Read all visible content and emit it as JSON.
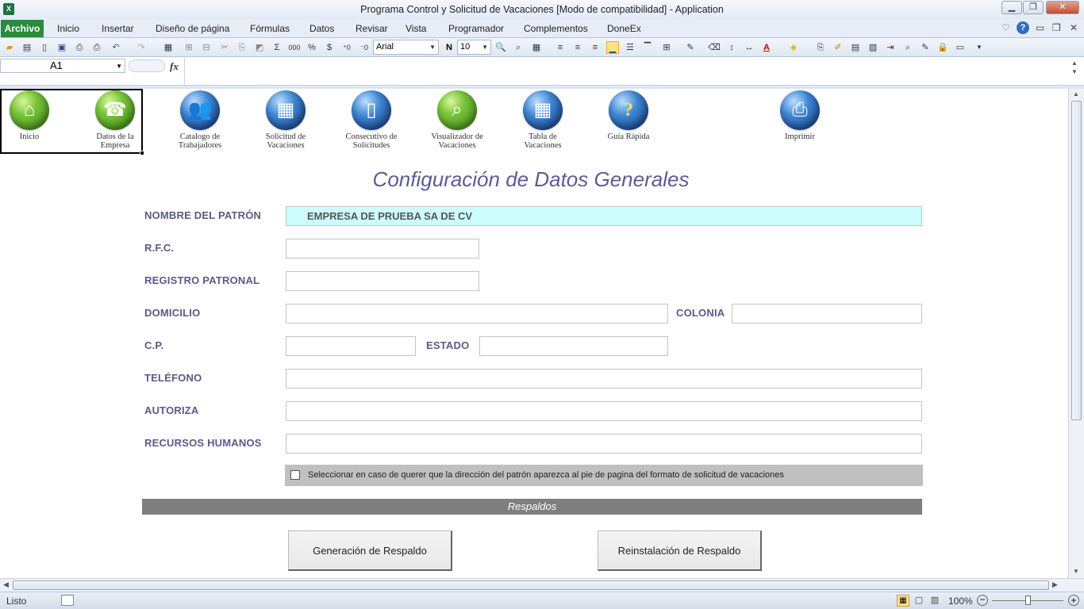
{
  "window": {
    "title": "Programa Control y Solicitud de Vacaciones  [Modo de compatibilidad]  -  Application",
    "app_icon": "X"
  },
  "ribbon_tabs": [
    "Archivo",
    "Inicio",
    "Insertar",
    "Diseño de página",
    "Fórmulas",
    "Datos",
    "Revisar",
    "Vista",
    "Programador",
    "Complementos",
    "DoneEx"
  ],
  "toolbar": {
    "font_name": "Arial",
    "font_size": "10"
  },
  "formula_bar": {
    "name_box": "A1",
    "fx": "fx",
    "formula": ""
  },
  "nav": [
    {
      "label": "Inicio",
      "icon": "home-icon"
    },
    {
      "label": "Datos de la Empresa",
      "icon": "telephone-icon"
    },
    {
      "label": "Catalogo de Trabajadores",
      "icon": "people-icon"
    },
    {
      "label": "Solicitud de Vacaciones",
      "icon": "calculator-icon"
    },
    {
      "label": "Consecutivo de Solicitudes",
      "icon": "document-icon"
    },
    {
      "label": "Visualizador de Vacaciones",
      "icon": "magnifier-icon"
    },
    {
      "label": "Tabla de Vacaciones",
      "icon": "table-icon"
    },
    {
      "label": "Guía Rápida",
      "icon": "help-icon"
    },
    {
      "label": "Imprimir",
      "icon": "printer-icon"
    }
  ],
  "page_title": "Configuración de Datos Generales",
  "form": {
    "nombre_label": "NOMBRE DEL PATRÓN",
    "nombre_value": "EMPRESA DE PRUEBA SA DE CV",
    "rfc_label": "R.F.C.",
    "registro_label": "REGISTRO PATRONAL",
    "domicilio_label": "DOMICILIO",
    "colonia_label": "COLONIA",
    "cp_label": "C.P.",
    "estado_label": "ESTADO",
    "telefono_label": "TELÉFONO",
    "autoriza_label": "AUTORIZA",
    "rh_label": "RECURSOS HUMANOS",
    "checkbox_text": "Seleccionar en caso de querer que la dirección del patrón aparezca al pie de pagina del formato de solicitud de vacaciones",
    "checkbox_checked": false
  },
  "respaldos": {
    "header": "Respaldos",
    "generate_label": "Generación  de Respaldo",
    "restore_label": "Reinstalación  de Respaldo"
  },
  "status": {
    "text": "Listo",
    "zoom": "100%"
  },
  "colors": {
    "label": "#5a5a86",
    "title": "#5b5b95",
    "highlight_field": "#ccfdff",
    "section_bar": "#7f7f7f",
    "archivo_tab": "#2a8a3e"
  }
}
